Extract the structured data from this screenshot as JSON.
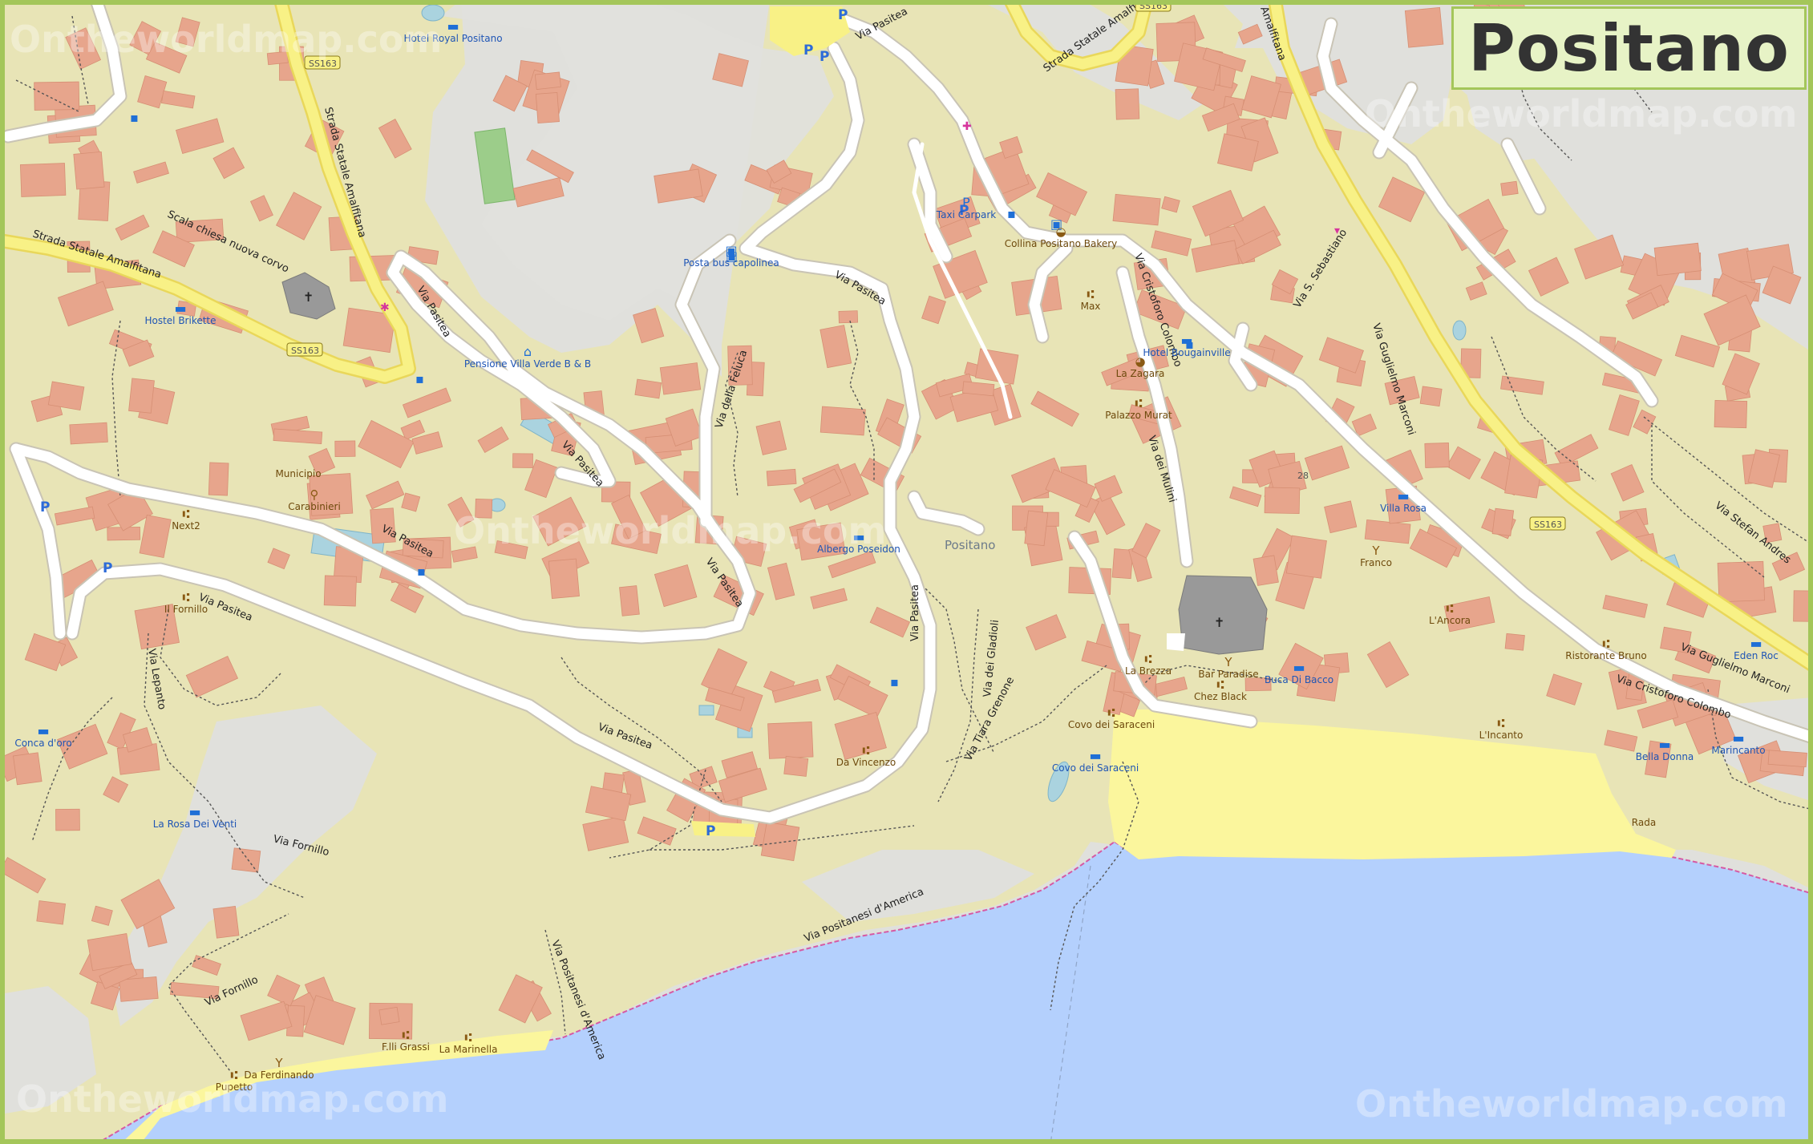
{
  "title": "Positano",
  "watermark": "Ontheworldmap.com",
  "place_name": "Positano",
  "house_number": "28",
  "colors": {
    "land": "#e8e4b6",
    "building": "#e7a58c",
    "building_stroke": "#d68f74",
    "road_major": "#f8f186",
    "road_major_casing": "#e9d75a",
    "road_minor": "#ffffff",
    "sea": "#b4d0fd",
    "beach": "#fbf69d",
    "rock": "#e0e0dc",
    "pitch": "#9ccd8a",
    "pool": "#aad3df",
    "coastline": "#d65aa4",
    "frame": "#a4c65a",
    "title_bg": "#e7f3c6",
    "poi_text": "#6e4a0d",
    "poi_blue": "#1f55b5",
    "church": "#999999"
  },
  "streets": [
    {
      "label": "Via Pasitea"
    },
    {
      "label": "Via Pasitea"
    },
    {
      "label": "Via Pasitea"
    },
    {
      "label": "Via Pasitea"
    },
    {
      "label": "Via Pasitea"
    },
    {
      "label": "Via Pasitea"
    },
    {
      "label": "Via Pasitea"
    },
    {
      "label": "Via Pasitea"
    },
    {
      "label": "Via Pasitea"
    },
    {
      "label": "Strada Statale Amalfitana"
    },
    {
      "label": "Strada Statale Amalfitana"
    },
    {
      "label": "Strada Statale Amalfitana"
    },
    {
      "label": "Amalfitana"
    },
    {
      "label": "Via Cristoforo Colombo"
    },
    {
      "label": "Via Cristoforo Colombo"
    },
    {
      "label": "Via dei Mulini"
    },
    {
      "label": "Via Guglielmo Marconi"
    },
    {
      "label": "Via Guglielmo Marconi"
    },
    {
      "label": "Via S. Sebastiano"
    },
    {
      "label": "Via Stefan Andres"
    },
    {
      "label": "Via della Feluca"
    },
    {
      "label": "Via dei Gladioli"
    },
    {
      "label": "Via Tiara Grenone"
    },
    {
      "label": "Via Positanesi d'America"
    },
    {
      "label": "Via Positanesi d'America"
    },
    {
      "label": "Via Fornillo"
    },
    {
      "label": "Via Fornillo"
    },
    {
      "label": "Via Lepanto"
    },
    {
      "label": "Scala chiesa nuova corvo"
    }
  ],
  "road_refs": [
    {
      "label": "SS163"
    },
    {
      "label": "SS163"
    },
    {
      "label": "SS163"
    },
    {
      "label": "SS163"
    }
  ],
  "pois": [
    {
      "label": "Hotel Royal Positano",
      "icon": "hotel"
    },
    {
      "label": "Hostel Brikette",
      "icon": "hostel"
    },
    {
      "label": "Pensione Villa Verde B & B",
      "icon": "guest-house"
    },
    {
      "label": "Posta bus capolinea",
      "icon": "bus-stop"
    },
    {
      "label": "Taxi Carpark",
      "icon": "parking"
    },
    {
      "label": "Collina Positano Bakery",
      "icon": "bakery"
    },
    {
      "label": "Max",
      "icon": "restaurant"
    },
    {
      "label": "Hotel Bougainville",
      "icon": "hotel"
    },
    {
      "label": "La Zagara",
      "icon": "cafe"
    },
    {
      "label": "Palazzo Murat",
      "icon": "restaurant"
    },
    {
      "label": "Municipio",
      "icon": "town-hall"
    },
    {
      "label": "Carabinieri",
      "icon": "police"
    },
    {
      "label": "Next2",
      "icon": "restaurant"
    },
    {
      "label": "Il Fornillo",
      "icon": "restaurant"
    },
    {
      "label": "Albergo Poseidon",
      "icon": "hotel"
    },
    {
      "label": "Da Vincenzo",
      "icon": "restaurant"
    },
    {
      "label": "Conca d'oro",
      "icon": "hotel"
    },
    {
      "label": "La Rosa Dei Venti",
      "icon": "hotel"
    },
    {
      "label": "Villa Rosa",
      "icon": "hotel"
    },
    {
      "label": "Franco",
      "icon": "bar"
    },
    {
      "label": "L'Ancora",
      "icon": "restaurant"
    },
    {
      "label": "Ristorante Bruno",
      "icon": "restaurant"
    },
    {
      "label": "Eden Roc",
      "icon": "hotel"
    },
    {
      "label": "La Brezza",
      "icon": "restaurant"
    },
    {
      "label": "Bar Paradise",
      "icon": "bar"
    },
    {
      "label": "Buca Di Bacco",
      "icon": "hotel"
    },
    {
      "label": "Chez Black",
      "icon": "restaurant"
    },
    {
      "label": "Covo dei Saraceni",
      "icon": "restaurant"
    },
    {
      "label": "Covo dei Saraceni",
      "icon": "hotel"
    },
    {
      "label": "L'Incanto",
      "icon": "restaurant"
    },
    {
      "label": "Bella Donna",
      "icon": "hotel"
    },
    {
      "label": "Marincanto",
      "icon": "hotel"
    },
    {
      "label": "Rada",
      "icon": "none"
    },
    {
      "label": "F.lli Grassi",
      "icon": "restaurant"
    },
    {
      "label": "La Marinella",
      "icon": "restaurant"
    },
    {
      "label": "Da Ferdinando",
      "icon": "bar"
    },
    {
      "label": "Pupetto",
      "icon": "restaurant"
    }
  ]
}
